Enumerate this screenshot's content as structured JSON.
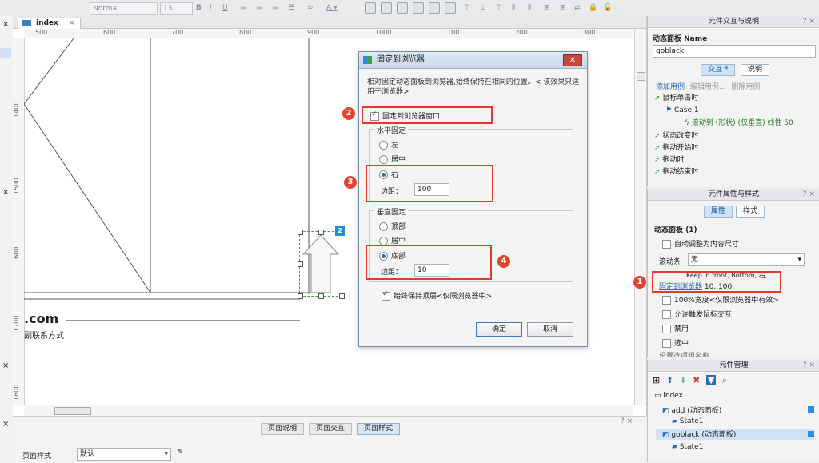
{
  "toolbar": {
    "style_value": "Normal",
    "size_value": "13"
  },
  "canvas": {
    "tab_label": "index",
    "ruler_top": [
      "500",
      "600",
      "700",
      "800",
      "900",
      "1000",
      "1100",
      "1200",
      "1300"
    ],
    "ruler_left": [
      "1400",
      "1500",
      "1600",
      "1700",
      "1800"
    ],
    "widget_badge": "2",
    "footer_domain": ".com",
    "footer_contact": "副联系方式"
  },
  "dialog": {
    "title": "固定到浏览器",
    "description": "相对固定动态面板到浏览器,始终保持在相同的位置。< 该效果只适用于浏览器>",
    "pin_label": "固定到浏览器窗口",
    "horizontal": {
      "group_label": "水平固定",
      "options": [
        "左",
        "居中",
        "右"
      ],
      "selected": "右",
      "margin_label": "边距：",
      "margin_value": "100"
    },
    "vertical": {
      "group_label": "垂直固定",
      "options": [
        "顶部",
        "居中",
        "底部"
      ],
      "selected": "底部",
      "margin_label": "边距：",
      "margin_value": "10"
    },
    "keep_top_label": "始终保持顶层<仅限浏览器中>",
    "ok_label": "确定",
    "cancel_label": "取消"
  },
  "annotations": [
    "1",
    "2",
    "3",
    "4"
  ],
  "interaction_panel": {
    "title": "元件交互与说明",
    "name_label": "动态面板 Name",
    "name_value": "goblack",
    "tab_interact": "交互 *",
    "tab_notes": "说明",
    "actions": [
      "添加用例",
      "编辑用例...",
      "删除用例"
    ],
    "events": {
      "click": "鼠标单击时",
      "case": "Case 1",
      "scroll_action": "滚动到 (形状) (仅垂直) 线性 50",
      "state_change": "状态改变时",
      "drag_start": "拖动开始时",
      "drag": "拖动时",
      "drag_end": "拖动结束时"
    }
  },
  "properties_panel": {
    "title": "元件属性与样式",
    "tab_props": "属性",
    "tab_style": "样式",
    "section": "动态面板 (1)",
    "auto_fit": "自动调整为内容尺寸",
    "scrollbar_label": "滚动条",
    "scrollbar_value": "无",
    "pin_tooltip": "Keep in front, Bottom, 右,",
    "pin_link": "固定到浏览器",
    "pin_value": "10, 100",
    "full_width": "100%宽度<仅限浏览器中有效>",
    "allow_trigger": "允许触发鼠标交互",
    "disabled": "禁用",
    "selected": "选中",
    "select_group": "设置选项组名称"
  },
  "widget_manager": {
    "title": "元件管理",
    "items": [
      {
        "label": "index"
      },
      {
        "label": "add (动态面板)"
      },
      {
        "label": "State1"
      },
      {
        "label": "goblack (动态面板)"
      },
      {
        "label": "State1"
      }
    ]
  },
  "bottom_panel": {
    "tabs": [
      "页面说明",
      "页面交互",
      "页面样式"
    ],
    "style_label": "页面样式",
    "style_value": "默认"
  },
  "colors": {
    "accent_red": "#e23b2a",
    "select_blue": "#2f6fb1",
    "widget_green": "#3aa34a"
  }
}
